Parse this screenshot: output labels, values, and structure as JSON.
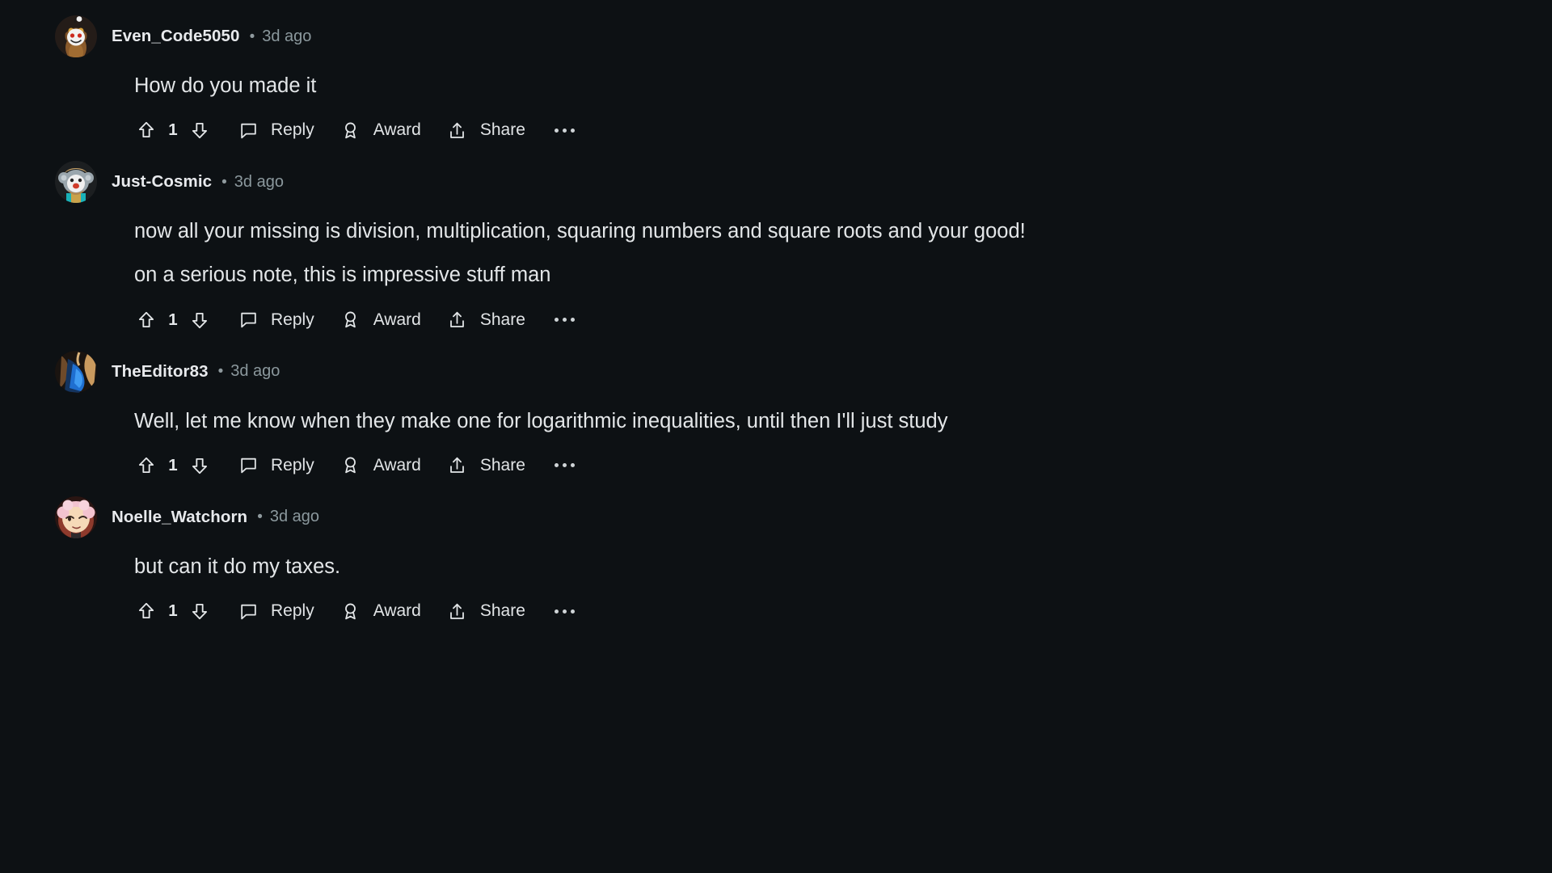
{
  "theme": {
    "background": "#0d1114",
    "text_primary": "#e3e6e8",
    "text_muted": "#8b989d"
  },
  "actions": {
    "upvote_icon": "upvote-arrow-icon",
    "downvote_icon": "downvote-arrow-icon",
    "reply_icon": "speech-bubble-icon",
    "reply_label": "Reply",
    "award_icon": "award-ribbon-icon",
    "award_label": "Award",
    "share_icon": "share-arrow-icon",
    "share_label": "Share",
    "more_icon": "overflow-ellipsis-icon"
  },
  "separator": "•",
  "comments": [
    {
      "username": "Even_Code5050",
      "timestamp": "3d ago",
      "avatar": "snoo-brown-costume-avatar",
      "paragraphs": [
        "How do you made it"
      ],
      "vote_count": "1"
    },
    {
      "username": "Just-Cosmic",
      "timestamp": "3d ago",
      "avatar": "snoo-grey-koala-avatar",
      "paragraphs": [
        "now all your missing is division, multiplication, squaring numbers and square roots and your good!",
        "on a serious note, this is impressive stuff man"
      ],
      "vote_count": "1"
    },
    {
      "username": "TheEditor83",
      "timestamp": "3d ago",
      "avatar": "blue-tan-artwork-avatar",
      "paragraphs": [
        "Well, let me know when they make one for logarithmic inequalities, until then I'll just study"
      ],
      "vote_count": "1"
    },
    {
      "username": "Noelle_Watchorn",
      "timestamp": "3d ago",
      "avatar": "pink-haired-anime-avatar",
      "paragraphs": [
        "but can it do my taxes."
      ],
      "vote_count": "1"
    }
  ]
}
